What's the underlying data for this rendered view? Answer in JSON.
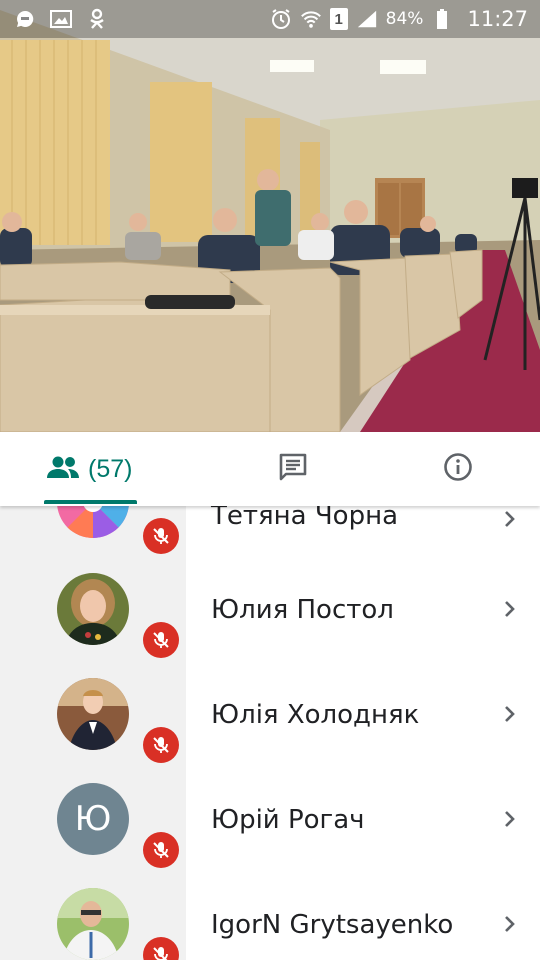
{
  "status_bar": {
    "battery_percent": "84%",
    "time": "11:27",
    "sim_slot": "1",
    "icons": [
      "messenger-icon",
      "gallery-icon",
      "odnoklassniki-icon",
      "alarm-icon",
      "wifi-icon",
      "sim-icon",
      "signal-icon",
      "battery-icon"
    ]
  },
  "video": {
    "description_icon": "video-feed-icon"
  },
  "tabs": {
    "participants_count": "(57)",
    "items": [
      {
        "icon": "people-icon",
        "active": true
      },
      {
        "icon": "chat-icon",
        "active": false
      },
      {
        "icon": "info-icon",
        "active": false
      }
    ],
    "accent": "#00796b"
  },
  "participants": [
    {
      "name": "Тетяна Чорна",
      "avatar": "photo",
      "muted": true
    },
    {
      "name": "Юлия Постол",
      "avatar": "photo",
      "muted": true
    },
    {
      "name": "Юлія Холодняк",
      "avatar": "photo",
      "muted": true
    },
    {
      "name": "Юрій Рогач",
      "avatar": "initial",
      "initial": "Ю",
      "muted": true
    },
    {
      "name": "IgorN Grytsayenko",
      "avatar": "photo",
      "muted": true
    }
  ],
  "colors": {
    "mute_badge": "#d93025",
    "initial_avatar": "#6f8591"
  }
}
